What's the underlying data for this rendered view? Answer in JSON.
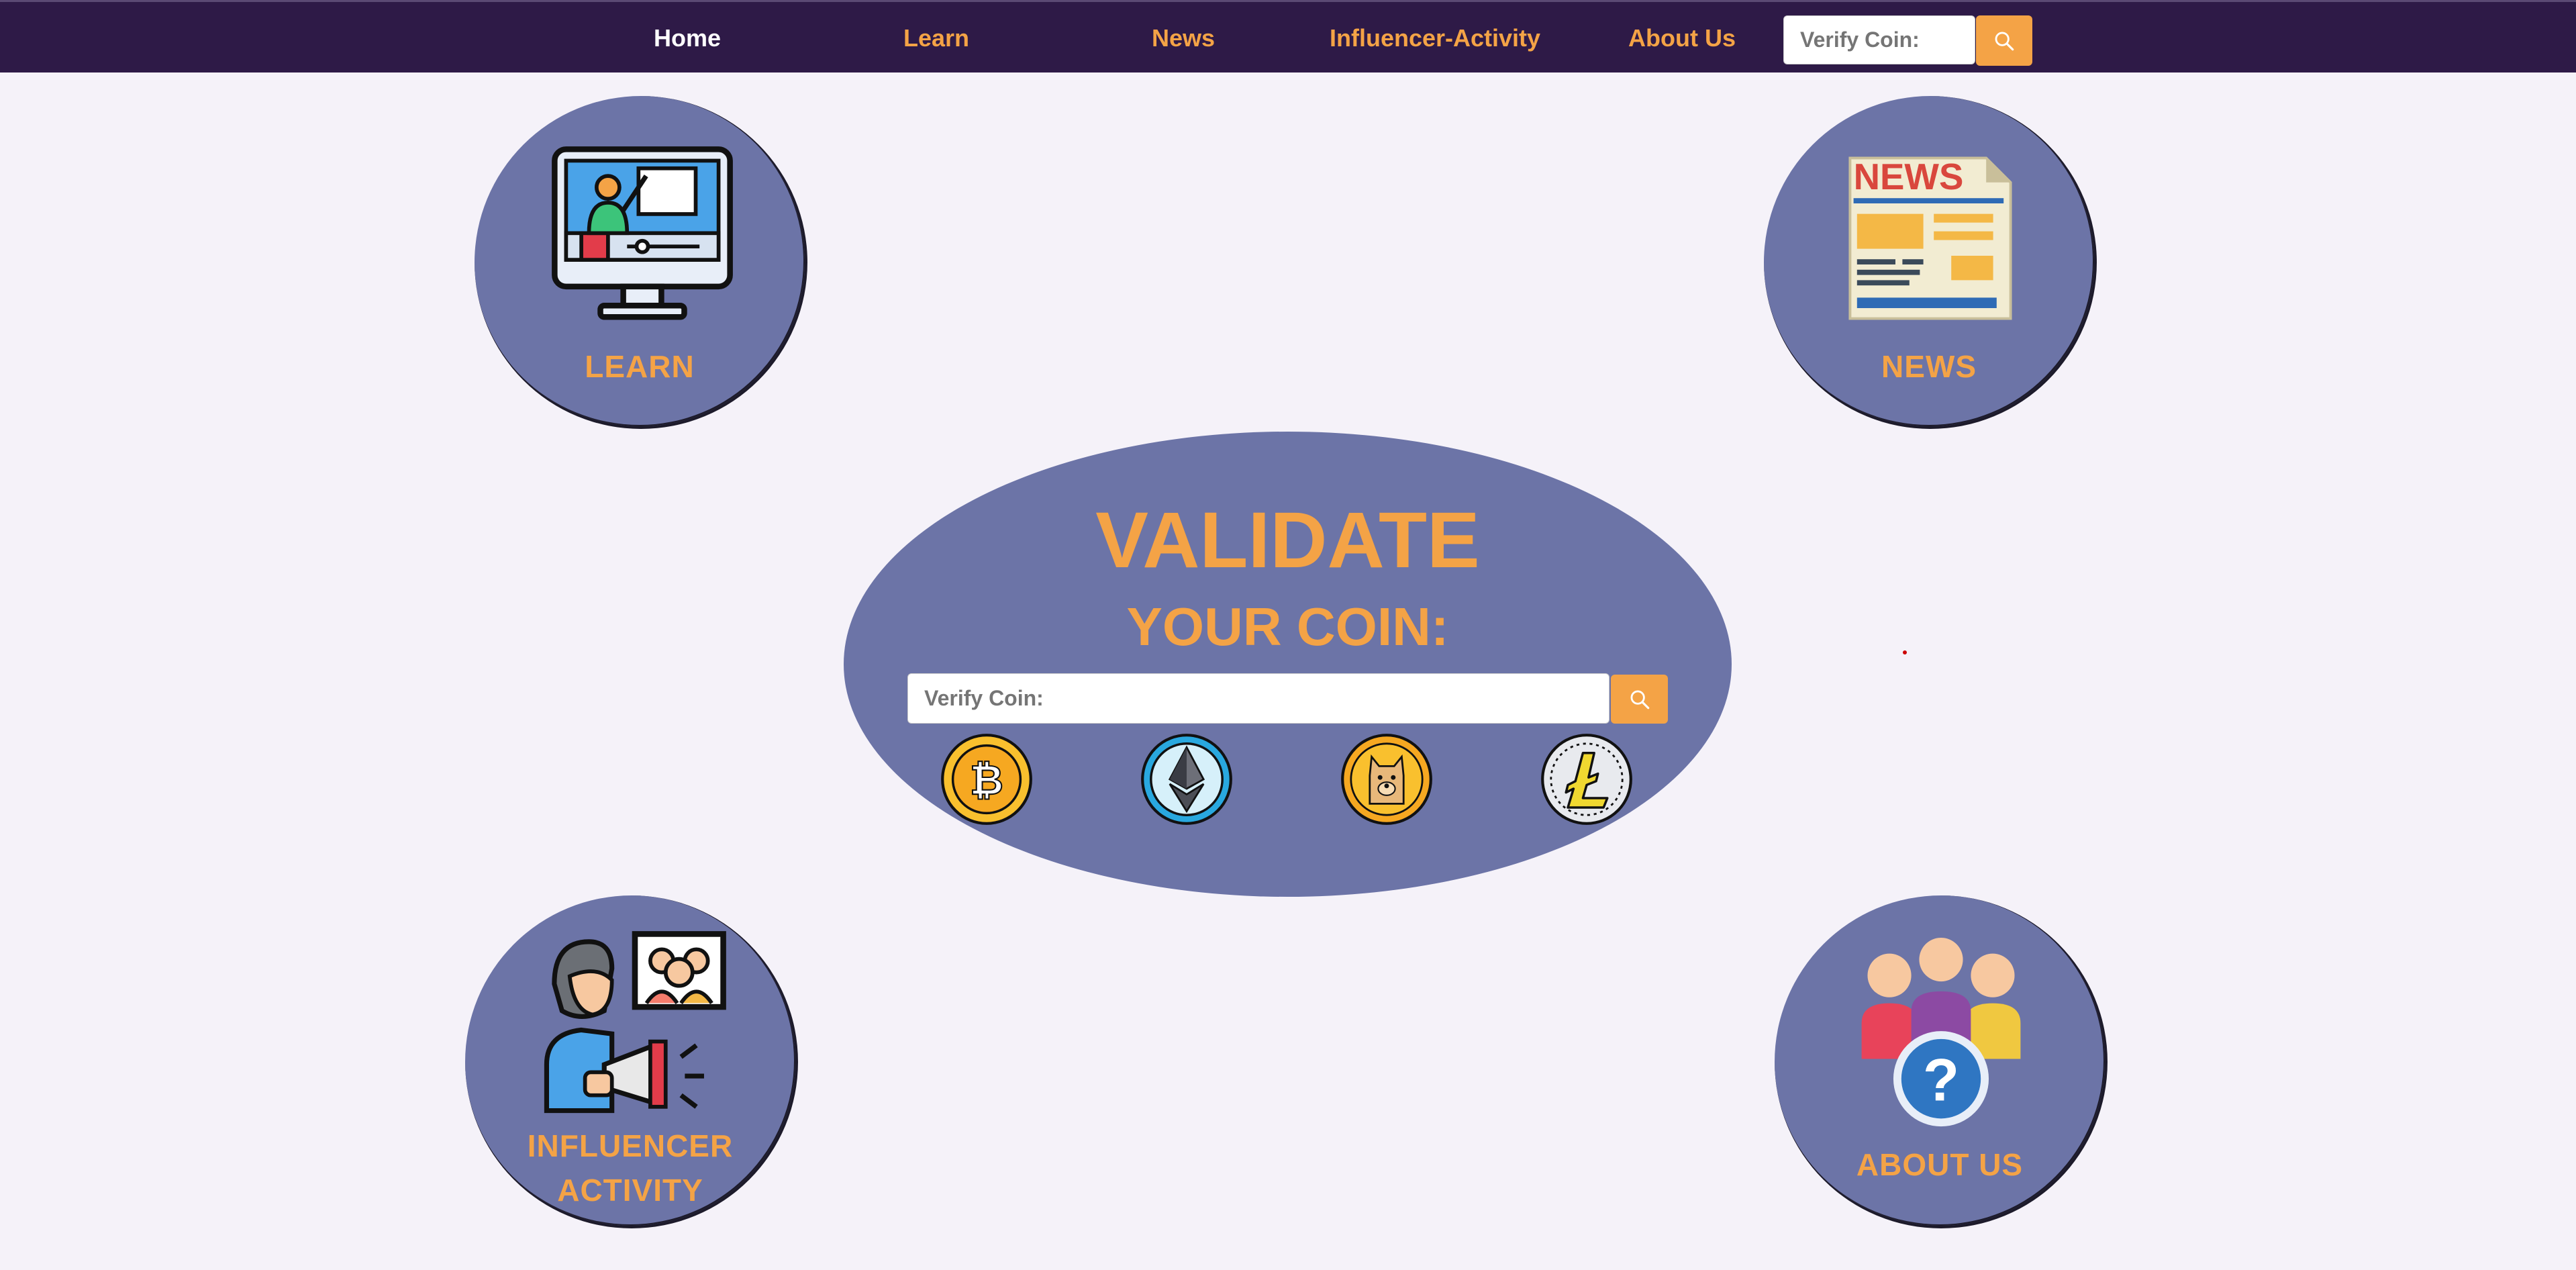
{
  "nav": {
    "items": [
      {
        "label": "Home",
        "active": true
      },
      {
        "label": "Learn"
      },
      {
        "label": "News"
      },
      {
        "label": "Influencer-Activity"
      },
      {
        "label": "About Us"
      }
    ],
    "search_placeholder": "Verify Coin:",
    "search_icon": "search-icon"
  },
  "cards": {
    "learn": "LEARN",
    "news": "NEWS",
    "influencer_line1": "INFLUENCER",
    "influencer_line2": "ACTIVITY",
    "about": "ABOUT US"
  },
  "hero": {
    "title": "VALIDATE",
    "subtitle": "YOUR COIN:",
    "placeholder": "Verify Coin:",
    "coins": [
      "bitcoin-icon",
      "ethereum-icon",
      "dogecoin-icon",
      "litecoin-icon"
    ]
  },
  "colors": {
    "nav_bg": "#2e1a47",
    "accent": "#f4a346",
    "circle": "#6c74a7",
    "page_bg": "#f5f2f9"
  }
}
